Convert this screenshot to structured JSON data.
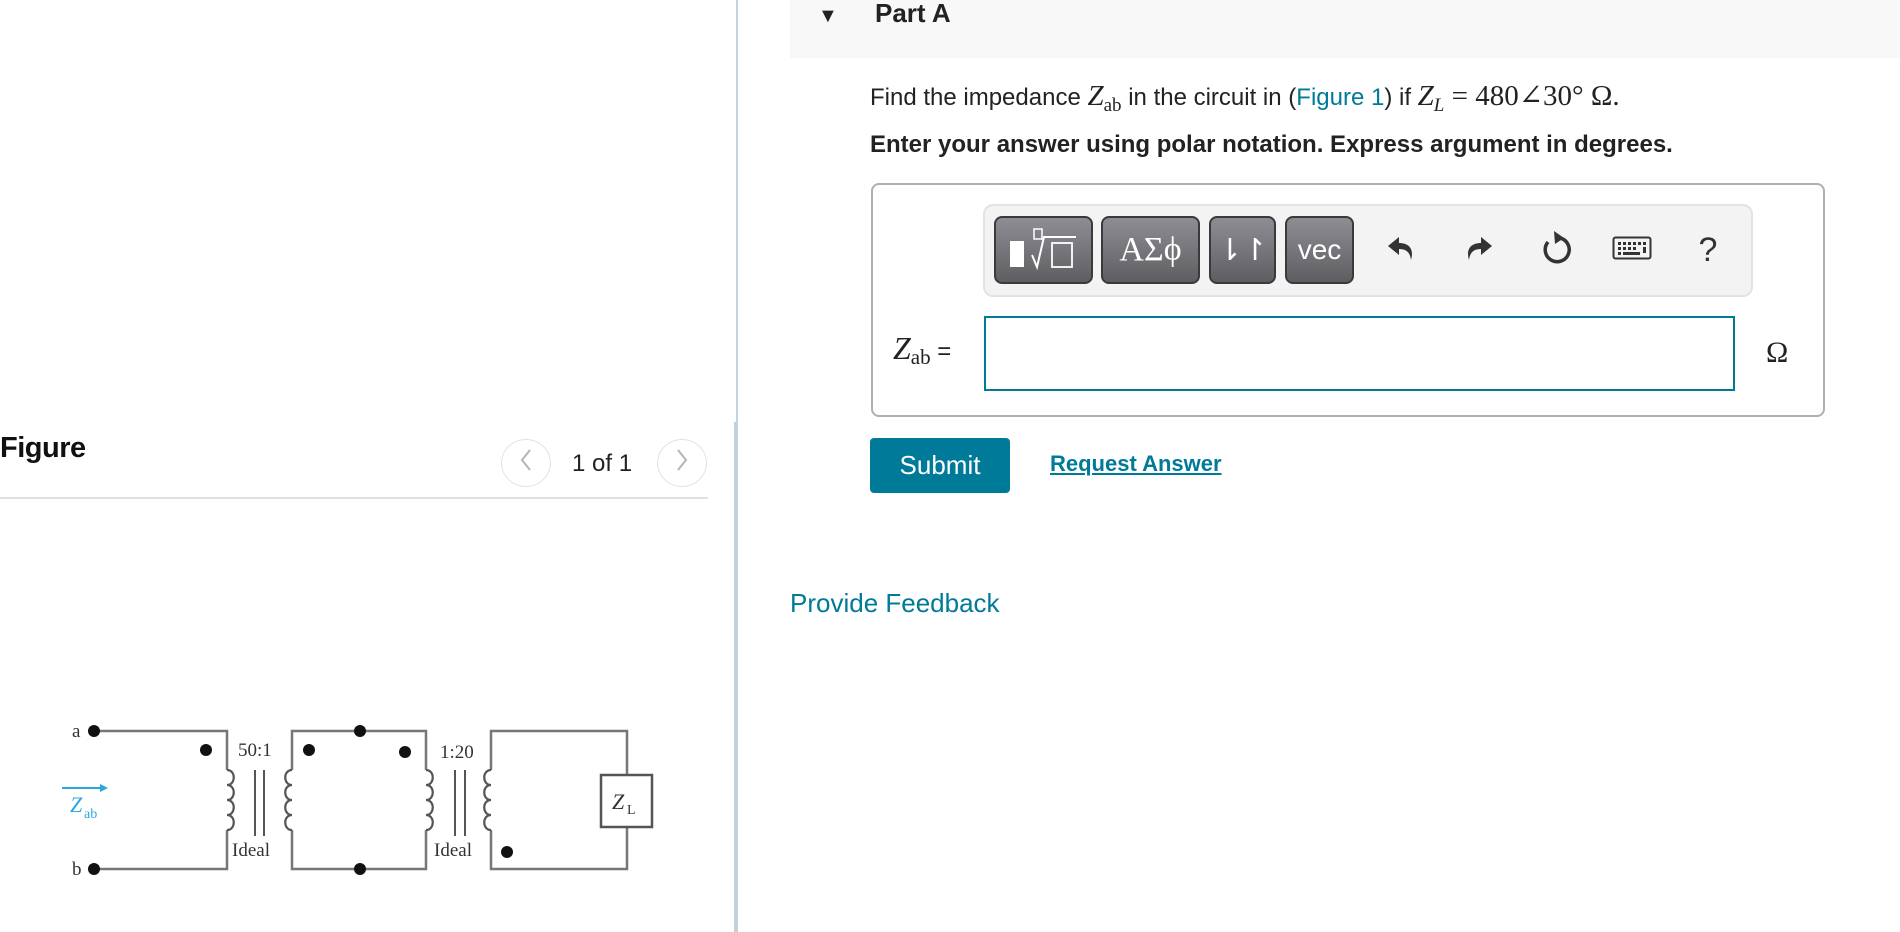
{
  "figure_panel": {
    "heading": "Figure",
    "pager": "1 of 1",
    "prev_icon": "chevron-left-icon",
    "next_icon": "chevron-right-icon",
    "prev_glyph": "〈",
    "next_glyph": "〉",
    "circuit": {
      "terminal_a": "a",
      "terminal_b": "b",
      "input_label_main": "Z",
      "input_label_sub": "ab",
      "transformer1_ratio": "50:1",
      "transformer1_type": "Ideal",
      "transformer2_ratio": "1:20",
      "transformer2_type": "Ideal",
      "load_label_main": "Z",
      "load_label_sub": "L",
      "arrow_color": "#29a8e0"
    }
  },
  "part": {
    "toggle_icon": "caret-down-icon",
    "toggle_glyph": "▼",
    "title": "Part A",
    "question": {
      "prefix": "Find the impedance ",
      "z_main": "Z",
      "z_sub": "ab",
      "middle": " in the circuit in (",
      "figure_link": "Figure 1",
      "suffix": ") if ",
      "zl_main": "Z",
      "zl_sub": "L",
      "zl_value": " = 480∠30° Ω."
    },
    "instructions": "Enter your answer using polar notation. Express argument in degrees."
  },
  "toolbar": {
    "templates_icon": "templates-icon",
    "greek_label": "ΑΣϕ",
    "arrows_label": "⇂↾",
    "vec_label": "vec",
    "undo_icon": "undo-icon",
    "redo_icon": "redo-icon",
    "reset_icon": "reset-icon",
    "keyboard_icon": "keyboard-icon",
    "help_label": "?"
  },
  "answer": {
    "label_main": "Z",
    "label_sub": "ab",
    "label_eq": " =",
    "value": "",
    "placeholder": "",
    "unit": "Ω"
  },
  "actions": {
    "submit_label": "Submit",
    "request_answer_label": "Request Answer"
  },
  "feedback_label": "Provide Feedback",
  "colors": {
    "accent": "#007a99",
    "header_bg": "#f8f8f8",
    "divider": "#c4d3e1"
  }
}
